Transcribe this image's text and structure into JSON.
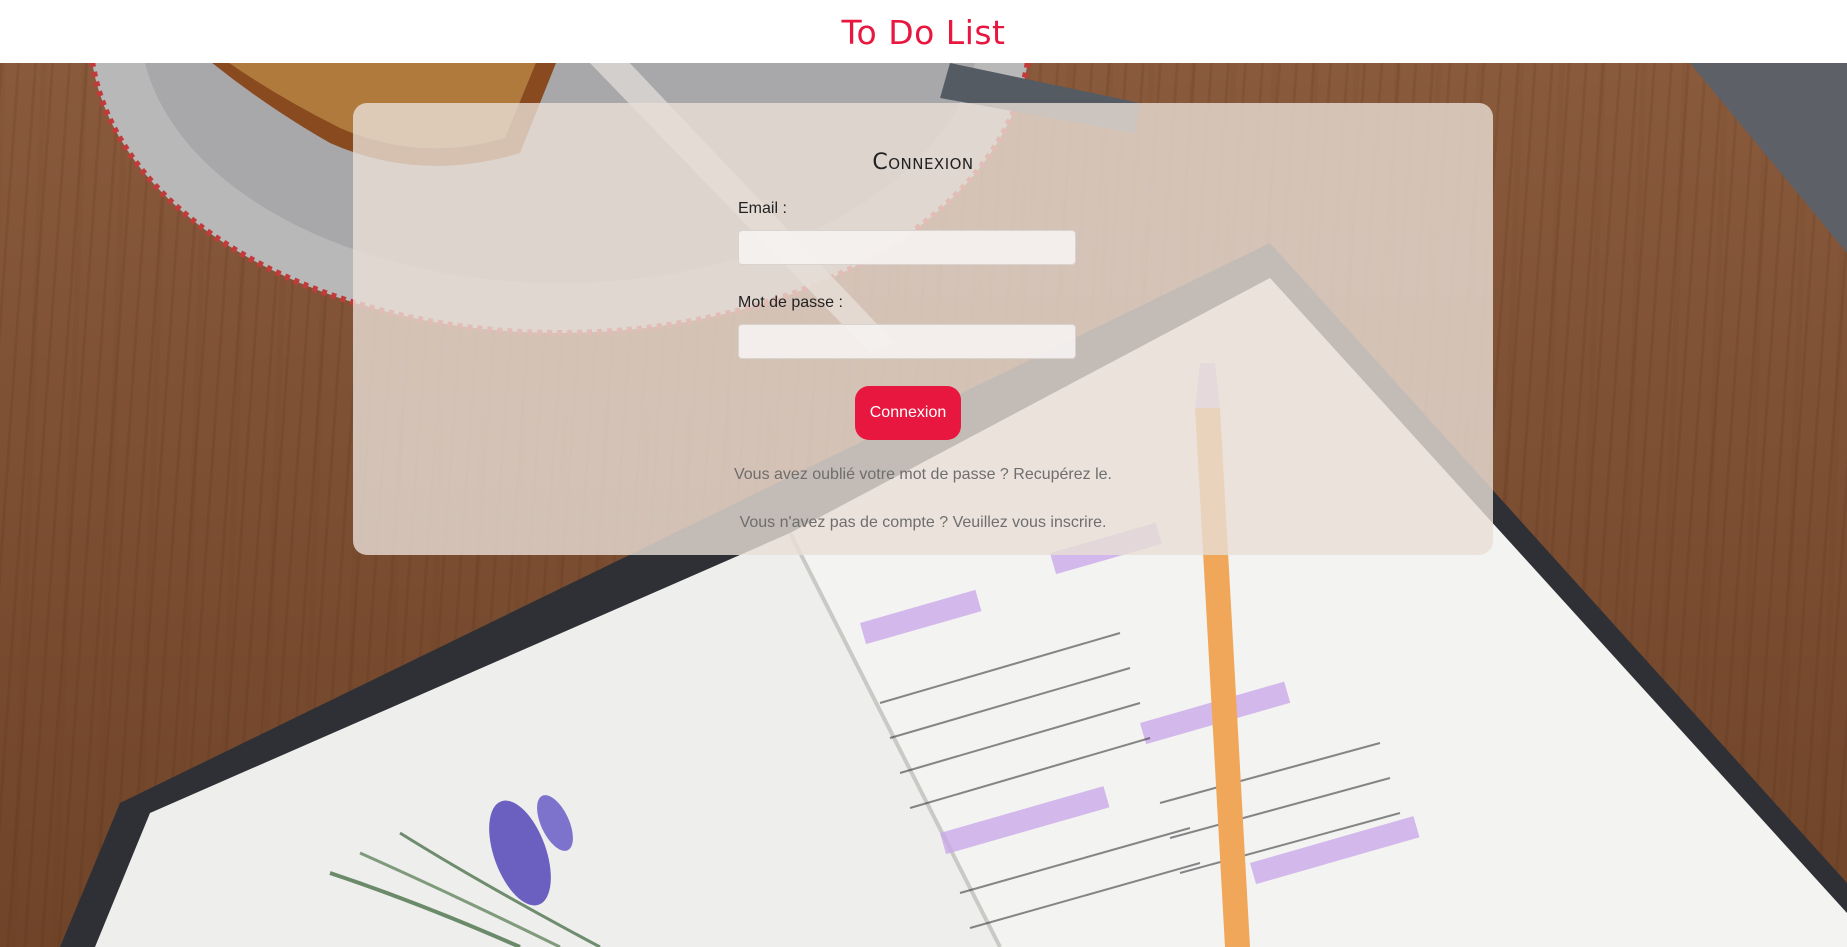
{
  "header": {
    "title": "To Do List"
  },
  "login": {
    "title": "Connexion",
    "email_label": "Email :",
    "email_value": "",
    "password_label": "Mot de passe :",
    "password_value": "",
    "submit_label": "Connexion",
    "forgot_text": "Vous avez oublié votre mot de passe ?",
    "forgot_link": "Recupérez le.",
    "register_text": "Vous n'avez pas de compte ?",
    "register_link": "Veuillez vous inscrire."
  },
  "colors": {
    "accent": "#e8173f",
    "card_background": "#e8ded6",
    "helper_text": "#6e6e6e"
  }
}
